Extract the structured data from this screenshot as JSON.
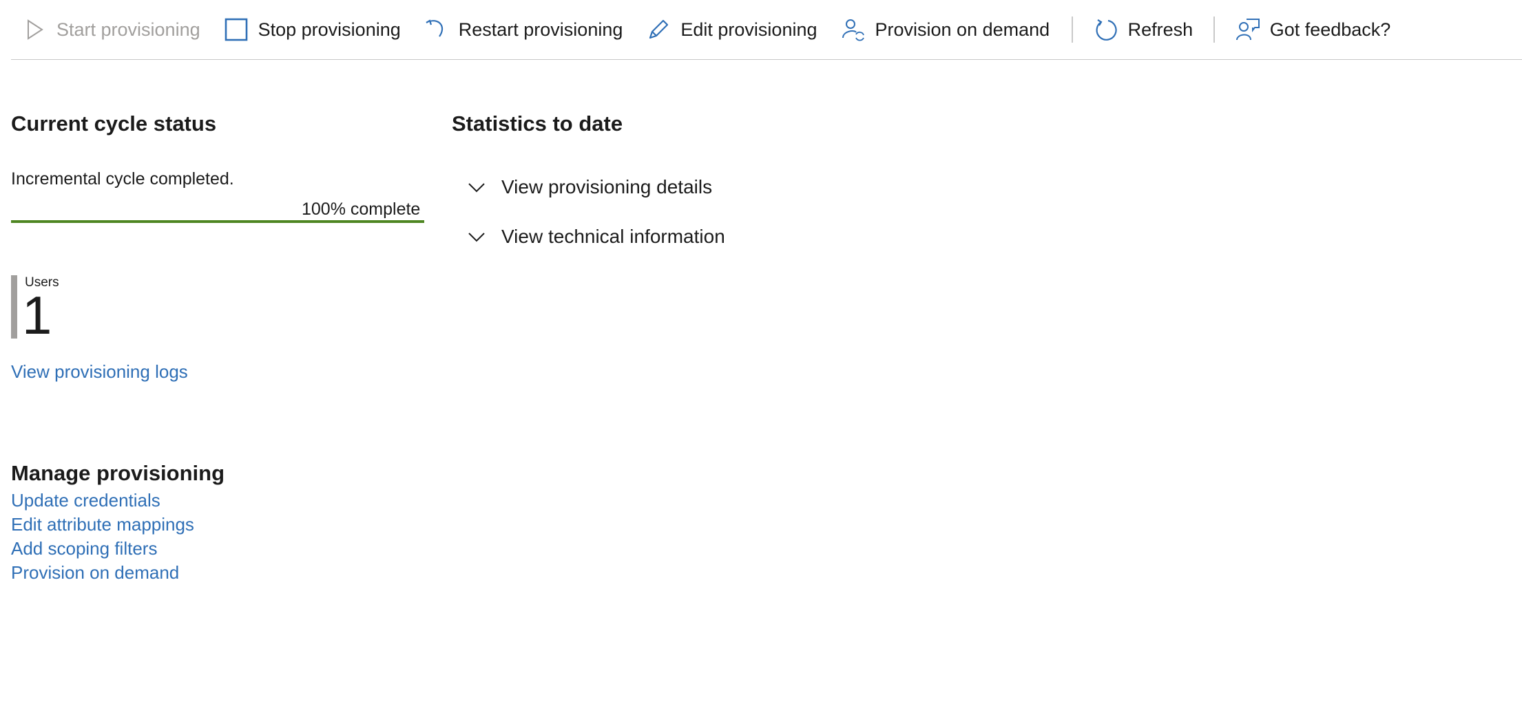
{
  "toolbar": {
    "start": "Start provisioning",
    "stop": "Stop provisioning",
    "restart": "Restart provisioning",
    "edit": "Edit provisioning",
    "provision_on_demand": "Provision on demand",
    "refresh": "Refresh",
    "feedback": "Got feedback?",
    "icons": {
      "start": "play-icon",
      "stop": "stop-square-icon",
      "restart": "restart-arrow-icon",
      "edit": "pencil-icon",
      "provision_on_demand": "user-sync-icon",
      "refresh": "refresh-icon",
      "feedback": "feedback-person-icon"
    }
  },
  "current_cycle": {
    "heading": "Current cycle status",
    "status_text": "Incremental cycle completed.",
    "progress_label": "100% complete",
    "progress_fraction": 1.0
  },
  "stats": {
    "label": "Users",
    "value": "1"
  },
  "view_logs_link": "View provisioning logs",
  "statistics": {
    "heading": "Statistics to date",
    "expanders": [
      {
        "label": "View provisioning details"
      },
      {
        "label": "View technical information"
      }
    ]
  },
  "manage": {
    "heading": "Manage provisioning",
    "links": [
      "Update credentials",
      "Edit attribute mappings",
      "Add scoping filters",
      "Provision on demand"
    ]
  },
  "colors": {
    "accent_blue": "#2f6fb6",
    "progress_green": "#4e8622",
    "disabled_gray": "#a19f9d"
  }
}
